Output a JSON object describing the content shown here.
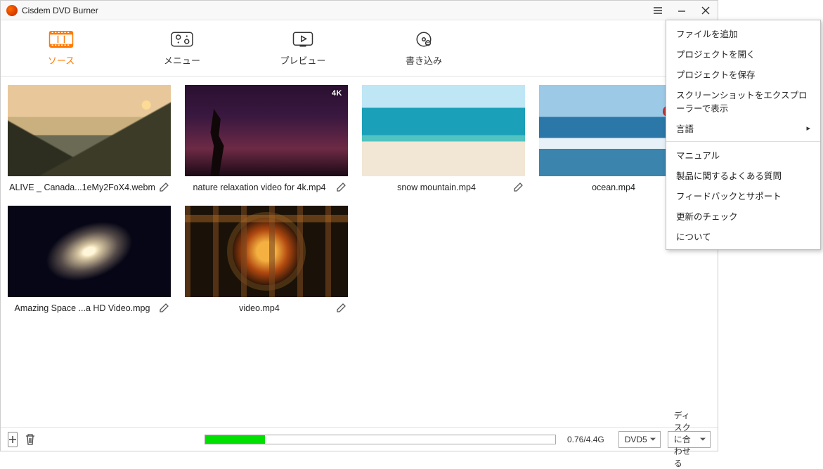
{
  "title": "Cisdem DVD Burner",
  "tabs": [
    {
      "label": "ソース"
    },
    {
      "label": "メニュー"
    },
    {
      "label": "プレビュー"
    },
    {
      "label": "書き込み"
    }
  ],
  "items": [
    {
      "name": "ALIVE _ Canada...1eMy2FoX4.webm",
      "has4k": false,
      "thumb": "mountain"
    },
    {
      "name": "nature relaxation video for 4k.mp4",
      "has4k": true,
      "thumb": "night"
    },
    {
      "name": "snow mountain.mp4",
      "has4k": false,
      "thumb": "beach"
    },
    {
      "name": "ocean.mp4",
      "has4k": true,
      "thumb": "ocean"
    },
    {
      "name": "Amazing Space ...a HD Video.mpg",
      "has4k": false,
      "thumb": "galaxy"
    },
    {
      "name": "video.mp4",
      "has4k": false,
      "thumb": "glass"
    }
  ],
  "status": {
    "progress_pct": 17,
    "size_text": "0.76/4.4G",
    "disc_type": "DVD5",
    "fit": "ディスクに合わせる"
  },
  "menu": {
    "items": [
      "ファイルを追加",
      "プロジェクトを開く",
      "プロジェクトを保存",
      "スクリーンショットをエクスプローラーで表示"
    ],
    "lang": "言語",
    "items2": [
      "マニュアル",
      "製品に関するよくある質問",
      "フィードバックとサポート",
      "更新のチェック",
      "について"
    ]
  },
  "badge4k": "4K"
}
